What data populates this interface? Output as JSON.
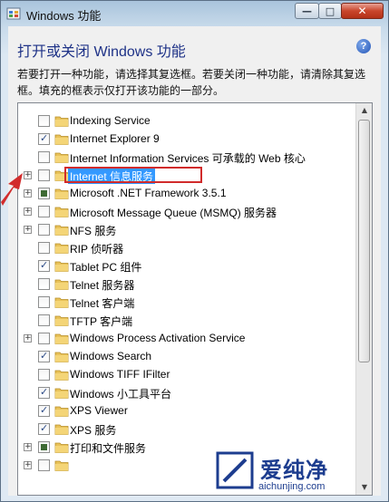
{
  "window": {
    "title": "Windows 功能",
    "buttons": {
      "minimize": "—",
      "maximize": "□",
      "close": "✕"
    }
  },
  "heading": "打开或关闭 Windows 功能",
  "help_label": "?",
  "description": "若要打开一种功能，请选择其复选框。若要关闭一种功能，请清除其复选框。填充的框表示仅打开该功能的一部分。",
  "features": [
    {
      "label": "Indexing Service",
      "state": "unchecked",
      "expandable": false
    },
    {
      "label": "Internet Explorer 9",
      "state": "checked",
      "expandable": false
    },
    {
      "label": "Internet Information Services 可承载的 Web 核心",
      "state": "unchecked",
      "expandable": false
    },
    {
      "label": "Internet 信息服务",
      "state": "unchecked",
      "expandable": true,
      "selected": true
    },
    {
      "label": "Microsoft .NET Framework 3.5.1",
      "state": "partial",
      "expandable": true
    },
    {
      "label": "Microsoft Message Queue (MSMQ) 服务器",
      "state": "unchecked",
      "expandable": true
    },
    {
      "label": "NFS 服务",
      "state": "unchecked",
      "expandable": true
    },
    {
      "label": "RIP 侦听器",
      "state": "unchecked",
      "expandable": false
    },
    {
      "label": "Tablet PC 组件",
      "state": "checked",
      "expandable": false
    },
    {
      "label": "Telnet 服务器",
      "state": "unchecked",
      "expandable": false
    },
    {
      "label": "Telnet 客户端",
      "state": "unchecked",
      "expandable": false
    },
    {
      "label": "TFTP 客户端",
      "state": "unchecked",
      "expandable": false
    },
    {
      "label": "Windows Process Activation Service",
      "state": "unchecked",
      "expandable": true
    },
    {
      "label": "Windows Search",
      "state": "checked",
      "expandable": false
    },
    {
      "label": "Windows TIFF IFilter",
      "state": "unchecked",
      "expandable": false
    },
    {
      "label": "Windows 小工具平台",
      "state": "checked",
      "expandable": false
    },
    {
      "label": "XPS Viewer",
      "state": "checked",
      "expandable": false
    },
    {
      "label": "XPS 服务",
      "state": "checked",
      "expandable": false
    },
    {
      "label": "打印和文件服务",
      "state": "partial",
      "expandable": true
    },
    {
      "label": "",
      "state": "unchecked",
      "expandable": true
    }
  ],
  "watermark": {
    "brand": "爱纯净",
    "url": "aichunjing.com"
  },
  "colors": {
    "selection": "#3399ff",
    "highlight_border": "#d12b2b",
    "heading": "#1e3287"
  }
}
